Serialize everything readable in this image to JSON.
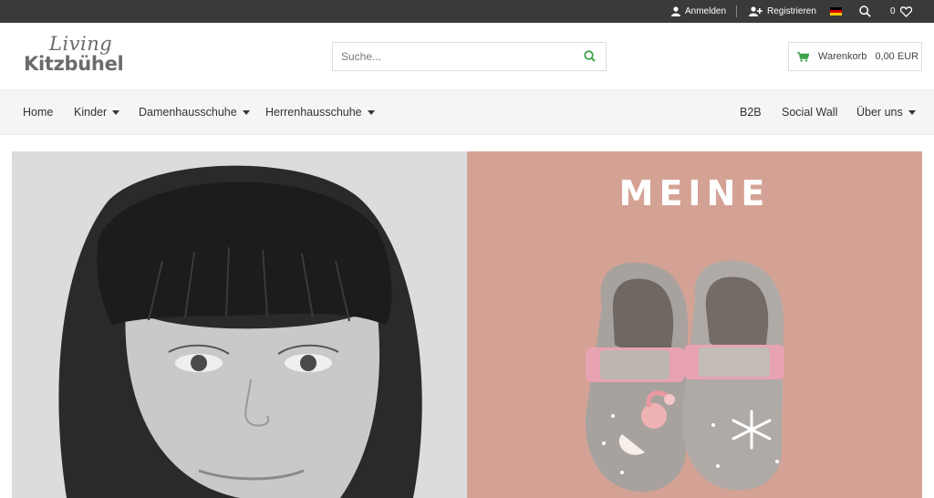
{
  "topbar": {
    "login_label": "Anmelden",
    "register_label": "Registrieren",
    "wishlist_count": "0",
    "icons": [
      "user-icon",
      "user-plus-icon",
      "german-flag-icon",
      "search-icon",
      "heart-icon"
    ]
  },
  "header": {
    "logo_script": "Living",
    "logo_brand": "Kitzbühel",
    "search_placeholder": "Suche...",
    "cart_label": "Warenkorb",
    "cart_amount": "0,00 EUR"
  },
  "nav": {
    "items": [
      {
        "label": "Home"
      },
      {
        "label": "Kinder"
      },
      {
        "label": "Damenhausschuhe"
      },
      {
        "label": "Herrenhausschuhe"
      },
      {
        "label": "B2B"
      },
      {
        "label": "Social Wall"
      },
      {
        "label": "Über uns"
      }
    ]
  },
  "hero": {
    "title": "MEINE"
  },
  "colors": {
    "topbar": "#3a3a3a",
    "accent_green": "#3fa34d",
    "hero_pink": "#d4a294",
    "nav_bg": "#f5f5f5"
  }
}
